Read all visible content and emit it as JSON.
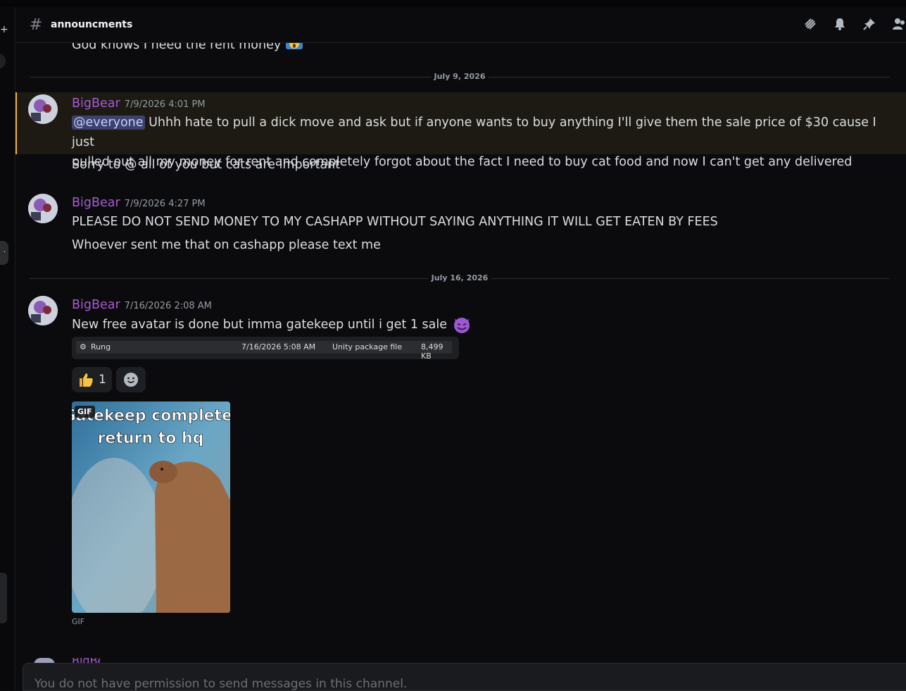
{
  "channel": {
    "name": "announcments"
  },
  "header_icons": [
    "threads-icon",
    "bell-icon",
    "pin-icon",
    "members-icon"
  ],
  "partial_message": {
    "text": "God knows I need the rent money",
    "emoji": "scream-face-icon"
  },
  "dividers": [
    "July 9, 2026",
    "July 16, 2026"
  ],
  "messages": [
    {
      "username": "BigBear",
      "timestamp": "7/9/2026 4:01 PM",
      "mention": "@everyone",
      "line1": " Uhhh hate to pull a dick move and ask but if anyone wants to buy anything I'll give them the sale price of $30 cause I just",
      "line2": "pulled out all my money for rent and completely forgot about the fact I need to buy cat food and now I can't get any delivered",
      "followup": "Sorry to @ all of you but cats are important"
    },
    {
      "username": "BigBear",
      "timestamp": "7/9/2026 4:27 PM",
      "line1": "PLEASE DO NOT SEND MONEY TO MY CASHAPP WITHOUT SAYING ANYTHING IT WILL GET EATEN BY FEES",
      "followup": "Whoever sent me that on cashapp please text me"
    },
    {
      "username": "BigBear",
      "timestamp": "7/16/2026 2:08 AM",
      "line1": "New free avatar is done but imma gatekeep until i get 1 sale",
      "emoji": "smiling-imp-icon",
      "attachment": {
        "name": "Rung",
        "date": "7/16/2026 5:08 AM",
        "type": "Unity package file",
        "size": "8,499 KB"
      },
      "reaction": {
        "emoji": "thumbs-up-icon",
        "count": "1"
      },
      "gif": {
        "caption_line1": "Gatekeep complete,",
        "caption_line2": "return to hq",
        "badge": "GIF",
        "label": "GIF"
      }
    }
  ],
  "composer": {
    "placeholder": "You do not have permission to send messages in this channel."
  },
  "colors": {
    "username": "#a85bd3",
    "mention_bg": "#3c4270",
    "highlight_border": "#f0b232",
    "background": "#0b0b0d"
  }
}
